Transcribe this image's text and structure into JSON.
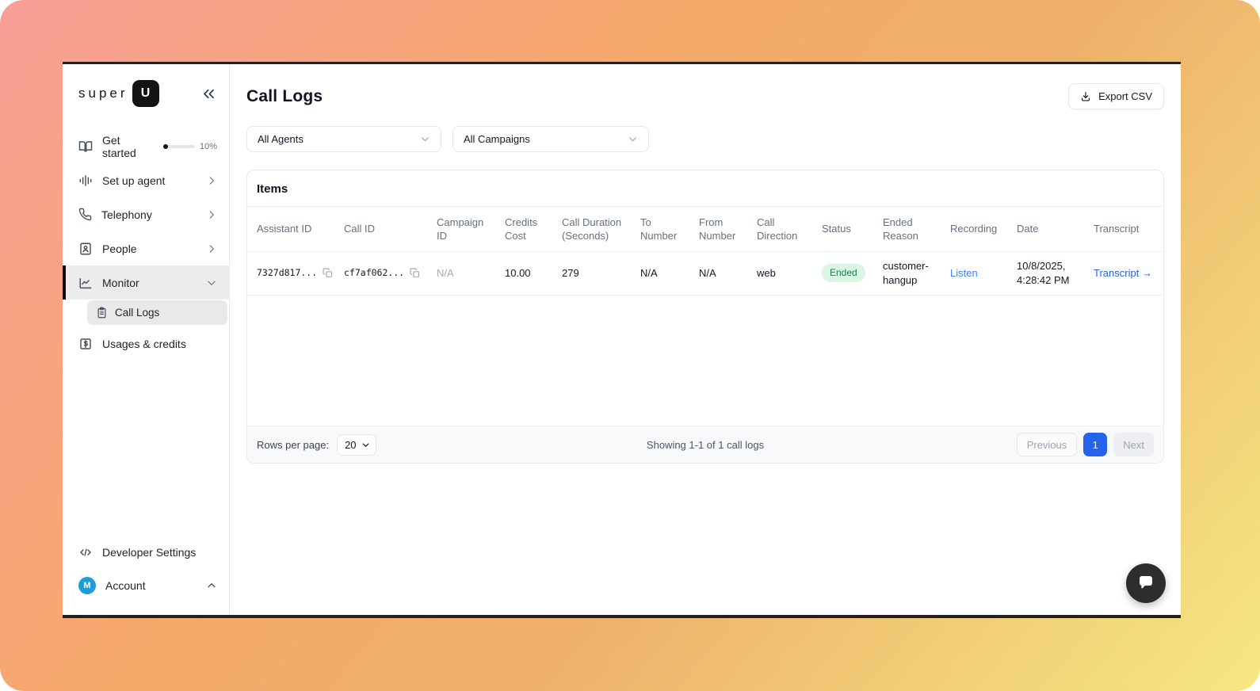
{
  "brand": {
    "logo_text": "super",
    "logo_badge": "U",
    "collapse_icon": "chevrons-left"
  },
  "sidebar": {
    "items": [
      {
        "label": "Get started",
        "icon": "book-icon",
        "progress_label": "10%"
      },
      {
        "label": "Set up agent",
        "icon": "waveform-icon"
      },
      {
        "label": "Telephony",
        "icon": "phone-icon"
      },
      {
        "label": "People",
        "icon": "person-card-icon"
      },
      {
        "label": "Monitor",
        "icon": "chart-icon"
      },
      {
        "label": "Call Logs",
        "icon": "clipboard-icon"
      },
      {
        "label": "Usages & credits",
        "icon": "dollar-icon"
      }
    ],
    "footer_items": [
      {
        "label": "Developer Settings",
        "icon": "code-icon"
      },
      {
        "label": "Account",
        "avatar_letter": "M"
      }
    ]
  },
  "header": {
    "title": "Call Logs",
    "export_button": "Export CSV"
  },
  "filters": {
    "agents_value": "All Agents",
    "campaigns_value": "All Campaigns"
  },
  "items_card": {
    "title": "Items",
    "columns": [
      "Assistant ID",
      "Call ID",
      "Campaign ID",
      "Credits Cost",
      "Call Duration (Seconds)",
      "To Number",
      "From Number",
      "Call Direction",
      "Status",
      "Ended Reason",
      "Recording",
      "Date",
      "Transcript"
    ],
    "row": {
      "assistant_id": "7327d817...",
      "call_id": "cf7af062...",
      "campaign_id": "N/A",
      "credits_cost": "10.00",
      "call_duration_seconds": "279",
      "to_number": "N/A",
      "from_number": "N/A",
      "call_direction": "web",
      "status": "Ended",
      "ended_reason": "customer-hangup",
      "recording_link": "Listen",
      "date": "10/8/2025, 4:28:42 PM",
      "transcript_link": "Transcript",
      "transcript_arrow": "→"
    }
  },
  "pagination": {
    "rows_per_page_label": "Rows per page:",
    "rows_per_page_value": "20",
    "summary": "Showing 1-1 of 1 call logs",
    "previous": "Previous",
    "page": "1",
    "next": "Next"
  },
  "colors": {
    "accent_blue": "#2563eb",
    "link_blue": "#3c82f6",
    "status_badge_bg": "#d9f6e3",
    "status_badge_text": "#177f4d",
    "gradient_start": "#f99e96",
    "gradient_mid": "#f5a96a",
    "gradient_end": "#f5e783"
  }
}
